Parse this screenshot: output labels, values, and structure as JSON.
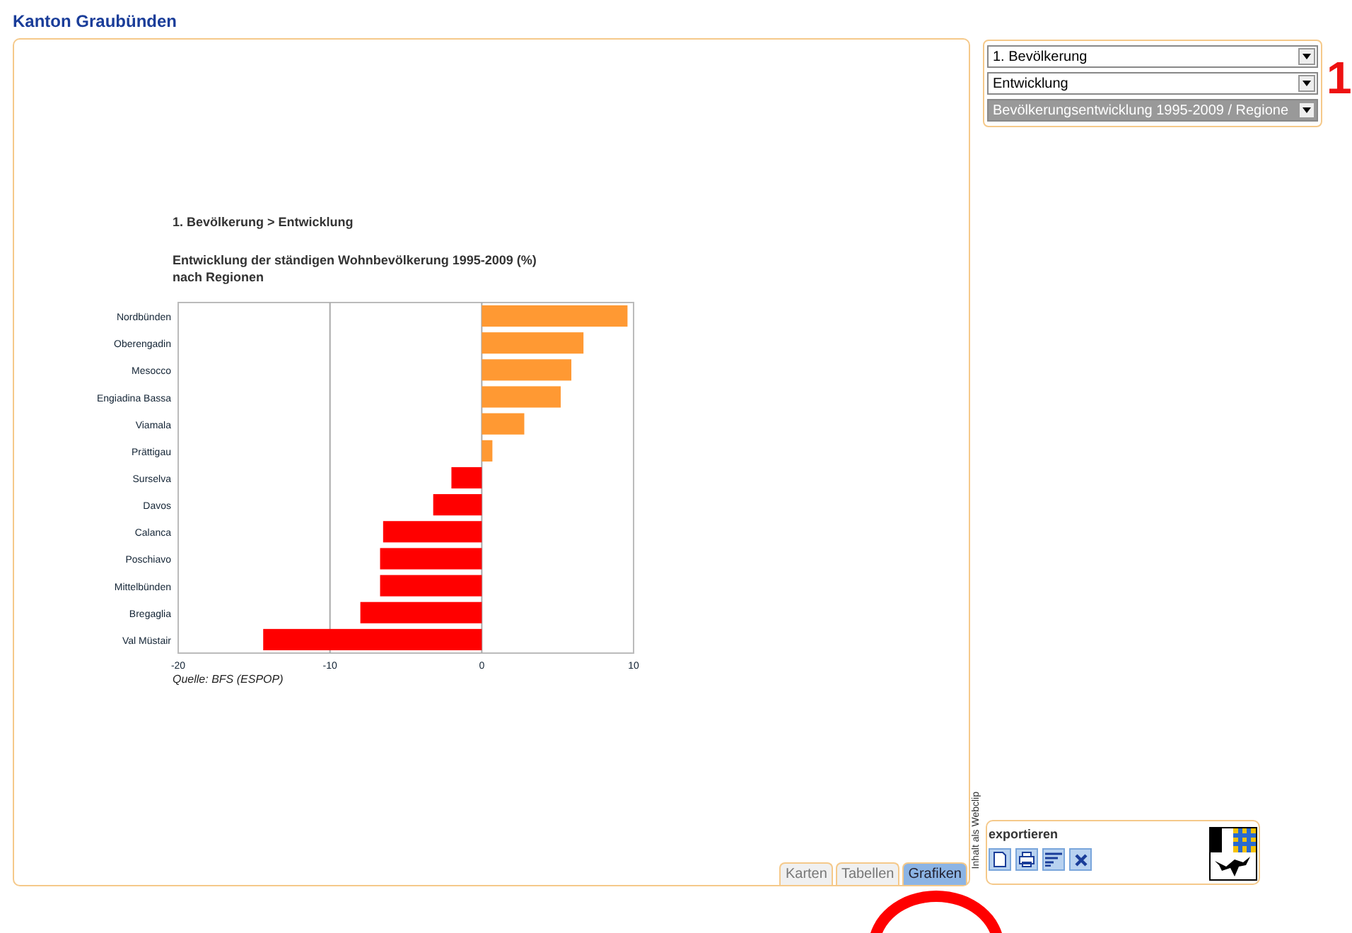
{
  "page_title": "Kanton Graubünden",
  "chart_panel": {
    "breadcrumb": "1. Bevölkerung > Entwicklung",
    "title_lines": [
      "Entwicklung der ständigen Wohnbevölkerung 1995-2009 (%)",
      "nach Regionen"
    ],
    "chart_data": {
      "type": "bar",
      "orientation": "horizontal",
      "stacked": true,
      "categories": [
        "Nordbünden",
        "Oberengadin",
        "Mesocco",
        "Engiadina Bassa",
        "Viamala",
        "Prättigau",
        "Surselva",
        "Davos",
        "Calanca",
        "Poschiavo",
        "Mittelbünden",
        "Bregaglia",
        "Val Müstair"
      ],
      "series": [
        {
          "color": "#ff9933",
          "values": [
            9.6,
            6.7,
            5.9,
            5.2,
            2.8,
            0.7,
            null,
            null,
            null,
            null,
            null,
            null,
            null
          ]
        },
        {
          "color": "#ff0000",
          "values": [
            null,
            null,
            null,
            null,
            null,
            null,
            -2.0,
            -3.2,
            -6.5,
            -6.7,
            -6.7,
            -8.0,
            -14.4
          ]
        }
      ],
      "xlim": [
        -20,
        10
      ],
      "xticks": [
        -20,
        -10,
        0,
        10
      ]
    },
    "source": "Quelle: BFS (ESPOP)"
  },
  "view_tabs": [
    {
      "label": "Karten",
      "selected": false
    },
    {
      "label": "Tabellen",
      "selected": false
    },
    {
      "label": "Grafiken",
      "selected": true
    }
  ],
  "webclip_label": "Inhalt als Webclip",
  "selectors": [
    {
      "value": "1. Bevölkerung",
      "disabled": false
    },
    {
      "value": "Entwicklung",
      "disabled": false
    },
    {
      "value": "Bevölkerungsentwicklung 1995-2009 / Regione",
      "disabled": true
    }
  ],
  "step_marker": "1",
  "export": {
    "title": "exportieren",
    "actions": [
      {
        "kind": "document"
      },
      {
        "kind": "print"
      },
      {
        "kind": "list"
      },
      {
        "kind": "close"
      }
    ]
  }
}
